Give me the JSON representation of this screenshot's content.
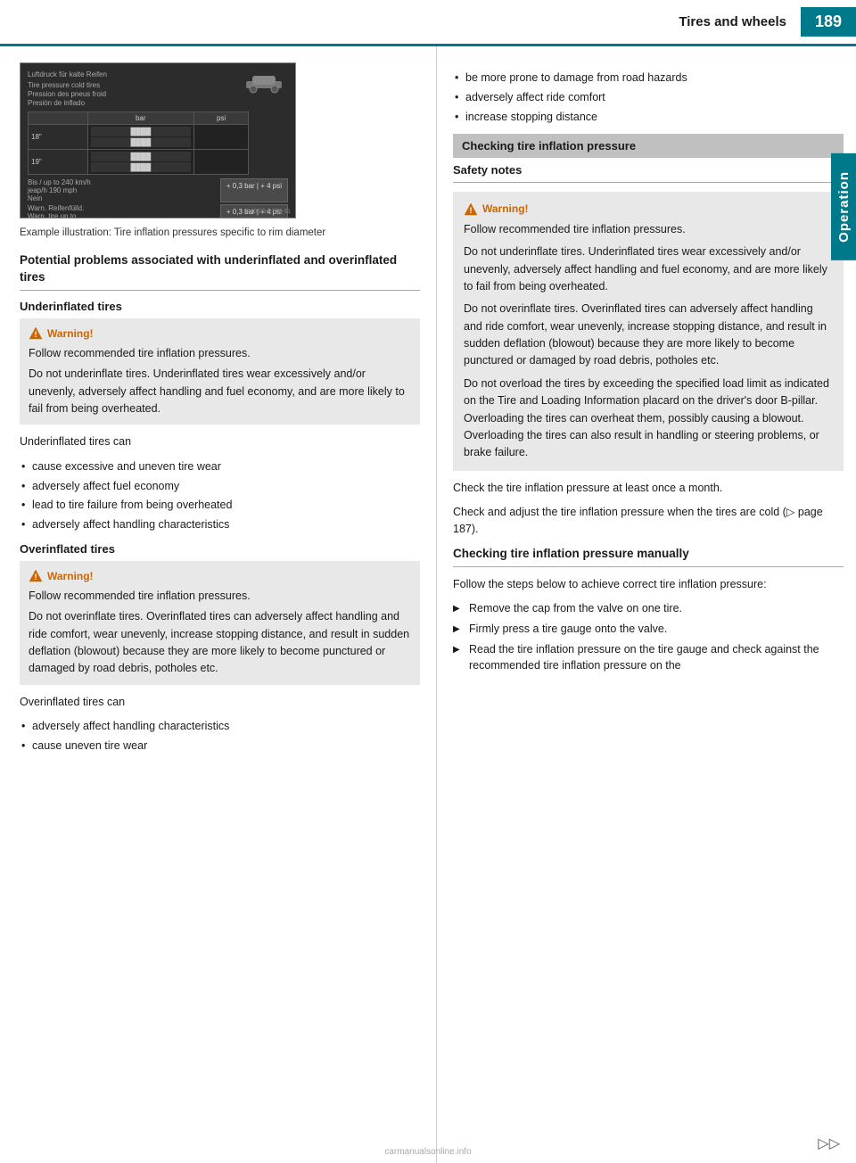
{
  "header": {
    "title": "Tires and wheels",
    "page_number": "189"
  },
  "side_tab": "Operation",
  "illustration": {
    "caption": "Example illustration: Tire inflation pressures\nspecific to rim diameter",
    "image_label": "P40.00-2178-31"
  },
  "left_column": {
    "section_title": "Potential problems associated with underinflated and overinflated tires",
    "underinflated": {
      "heading": "Underinflated tires",
      "warning_title": "Warning!",
      "warning_line1": "Follow recommended tire inflation pressures.",
      "warning_para": "Do not underinflate tires. Underinflated tires wear excessively and/or unevenly, adversely affect handling and fuel economy, and are more likely to fail from being overheated.",
      "intro": "Underinflated tires can",
      "bullets": [
        "cause excessive and uneven tire wear",
        "adversely affect fuel economy",
        "lead to tire failure from being overheated",
        "adversely affect handling characteristics"
      ]
    },
    "overinflated": {
      "heading": "Overinflated tires",
      "warning_title": "Warning!",
      "warning_line1": "Follow recommended tire inflation pressures.",
      "warning_para": "Do not overinflate tires. Overinflated tires can adversely affect handling and ride comfort, wear unevenly, increase stopping distance, and result in sudden deflation (blowout) because they are more likely to become punctured or damaged by road debris, potholes etc.",
      "intro": "Overinflated tires can",
      "bullets": [
        "adversely affect handling characteristics",
        "cause uneven tire wear"
      ]
    }
  },
  "right_column": {
    "bullet_items_overinflated": [
      "be more prone to damage from road hazards",
      "adversely affect ride comfort",
      "increase stopping distance"
    ],
    "checking_section": {
      "heading": "Checking tire inflation pressure",
      "safety_notes_heading": "Safety notes",
      "warning_title": "Warning!",
      "warning_para1": "Follow recommended tire inflation pressures.",
      "warning_para2": "Do not underinflate tires. Underinflated tires wear excessively and/or unevenly, adversely affect handling and fuel economy, and are more likely to fail from being overheated.",
      "warning_para3": "Do not overinflate tires. Overinflated tires can adversely affect handling and ride comfort, wear unevenly, increase stopping distance, and result in sudden deflation (blowout) because they are more likely to become punctured or damaged by road debris, potholes etc.",
      "warning_para4": "Do not overload the tires by exceeding the specified load limit as indicated on the Tire and Loading Information placard on the driver's door B-pillar. Overloading the tires can overheat them, possibly causing a blowout. Overloading the tires can also result in handling or steering problems, or brake failure."
    },
    "check_monthly": "Check the tire inflation pressure at least once a month.",
    "check_cold": "Check and adjust the tire inflation pressure when the tires are cold (▷ page 187).",
    "manually_section": {
      "heading": "Checking tire inflation pressure manually",
      "intro": "Follow the steps below to achieve correct tire inflation pressure:",
      "steps": [
        "Remove the cap from the valve on one tire.",
        "Firmly press a tire gauge onto the valve.",
        "Read the tire inflation pressure on the tire gauge and check against the recommended tire inflation pressure on the"
      ]
    },
    "page_nav": "▷▷"
  }
}
